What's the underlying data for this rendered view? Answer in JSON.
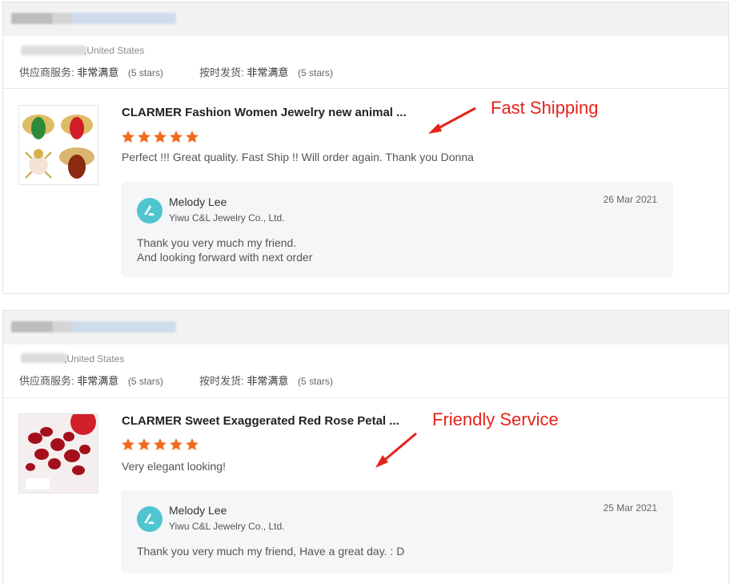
{
  "reviews": [
    {
      "country": ",United States",
      "supplier_service_label": "供应商服务:",
      "supplier_service_value": "非常满意",
      "supplier_service_stars": "(5 stars)",
      "shipping_label": "按时发货:",
      "shipping_value": "非常满意",
      "shipping_stars": "(5 stars)",
      "product_title": "CLARMER Fashion Women Jewelry new animal ...",
      "rating": 5,
      "review_text": "Perfect !!! Great quality. Fast Ship !! Will order again. Thank you Donna",
      "reply": {
        "seller_name": "Melody Lee",
        "company": "Yiwu C&L Jewelry Co., Ltd.",
        "date": "26 Mar 2021",
        "lines": [
          "Thank you very much my friend.",
          "And looking forward with next order"
        ]
      },
      "annotation": "Fast Shipping"
    },
    {
      "country": ",United States",
      "supplier_service_label": "供应商服务:",
      "supplier_service_value": "非常满意",
      "supplier_service_stars": "(5 stars)",
      "shipping_label": "按时发货:",
      "shipping_value": "非常满意",
      "shipping_stars": "(5 stars)",
      "product_title": "CLARMER Sweet Exaggerated Red Rose Petal ...",
      "rating": 5,
      "review_text": "Very elegant looking!",
      "reply": {
        "seller_name": "Melody Lee",
        "company": "Yiwu C&L Jewelry Co., Ltd.",
        "date": "25 Mar 2021",
        "lines": [
          "Thank you very much my friend, Have a great day. : D"
        ]
      },
      "annotation": "Friendly Service"
    }
  ],
  "colors": {
    "star": "#f26b1d",
    "annotation": "#e5231b",
    "avatar": "#4fc6cf",
    "reply_bg": "#f5f6f8"
  },
  "icons": {
    "star": "star-icon",
    "avatar": "company-logo-avatar",
    "annotation_arrow": "red-arrow"
  }
}
